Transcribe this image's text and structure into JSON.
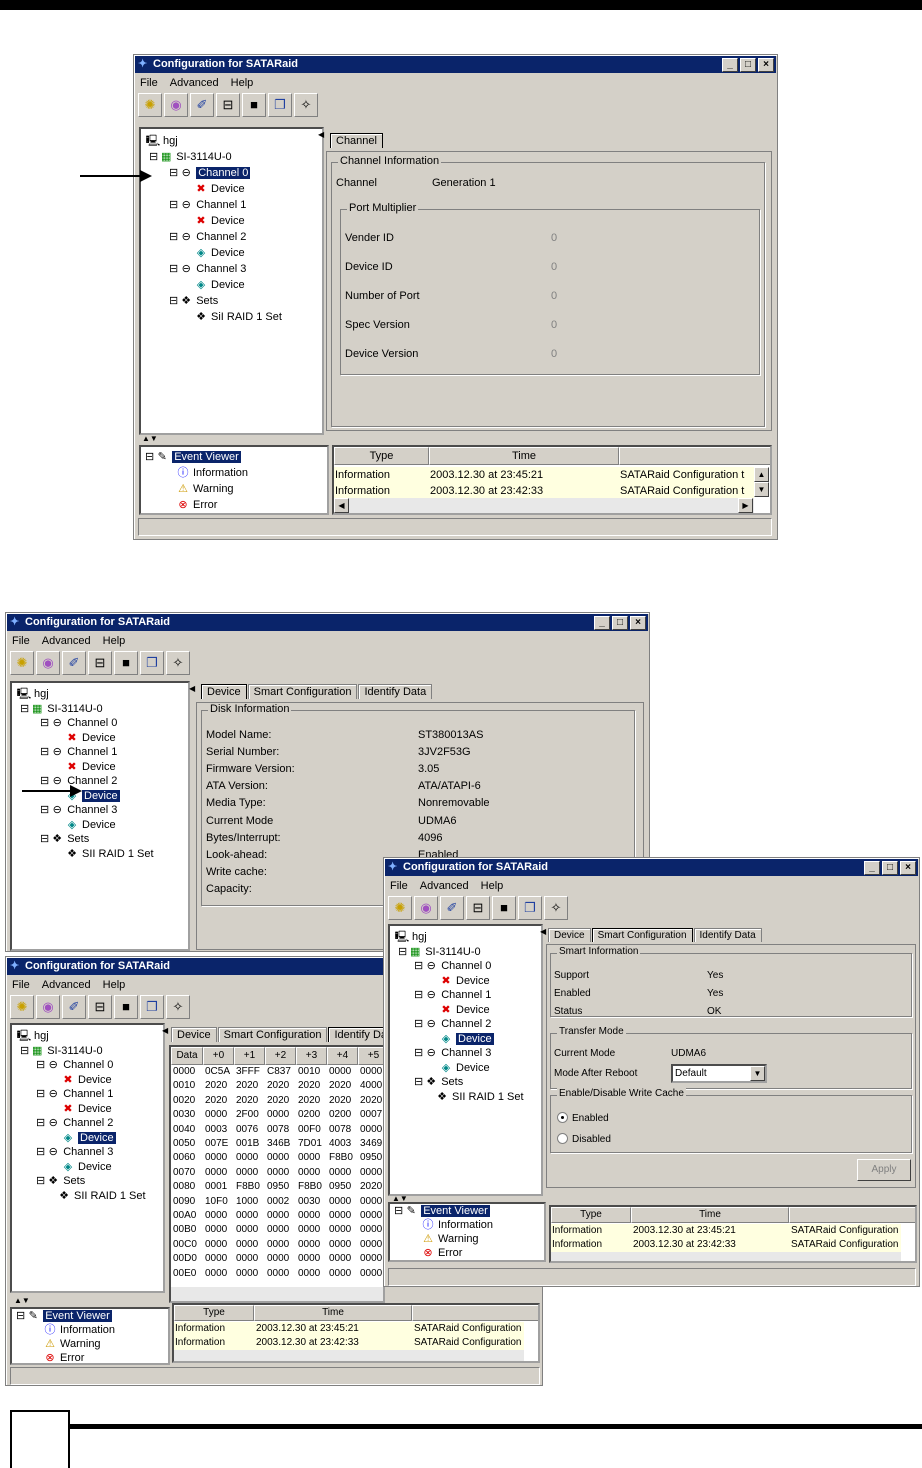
{
  "window_title": "Configuration for SATARaid",
  "title_buttons": [
    "_",
    "□",
    "×"
  ],
  "menu": [
    "File",
    "Advanced",
    "Help"
  ],
  "toolbar_icons": [
    "rescan-icon",
    "cd-icon",
    "wizard-icon",
    "drive-icon",
    "save-icon",
    "copy-icon",
    "find-icon"
  ],
  "tree": {
    "root": "hgj",
    "controller": "SI-3114U-0",
    "ch0": "Channel 0",
    "ch1": "Channel 1",
    "ch2": "Channel 2",
    "ch3": "Channel 3",
    "device": "Device",
    "sets": "Sets",
    "set1": "SiI RAID 1 Set",
    "set1b": "SII RAID 1 Set"
  },
  "events": {
    "viewer": "Event Viewer",
    "info": "Information",
    "warning": "Warning",
    "error": "Error",
    "cols": [
      "Type",
      "Time"
    ],
    "rows": [
      {
        "type": "Information",
        "time": "2003.12.30 at 23:45:21",
        "msg": "SATARaid Configuration t"
      },
      {
        "type": "Information",
        "time": "2003.12.30 at 23:42:33",
        "msg": "SATARaid Configuration t"
      }
    ]
  },
  "channel_tab": {
    "tab": "Channel",
    "group": "Channel Information",
    "channel_label": "Channel",
    "channel_value": "Generation 1",
    "pm_group": "Port Multiplier",
    "pm_rows": [
      {
        "label": "Vender ID",
        "value": "0"
      },
      {
        "label": "Device ID",
        "value": "0"
      },
      {
        "label": "Number of Port",
        "value": "0"
      },
      {
        "label": "Spec Version",
        "value": "0"
      },
      {
        "label": "Device Version",
        "value": "0"
      }
    ]
  },
  "device_tabs": [
    "Device",
    "Smart Configuration",
    "Identify Data"
  ],
  "disk": {
    "group": "Disk Information",
    "rows": [
      {
        "label": "Model Name:",
        "value": "ST380013AS"
      },
      {
        "label": "Serial Number:",
        "value": "3JV2F53G"
      },
      {
        "label": "Firmware Version:",
        "value": "3.05"
      },
      {
        "label": "ATA Version:",
        "value": "ATA/ATAPI-6"
      },
      {
        "label": "Media Type:",
        "value": "Nonremovable"
      },
      {
        "label": "Current Mode",
        "value": "UDMA6"
      },
      {
        "label": "Bytes/Interrupt:",
        "value": "4096"
      },
      {
        "label": "Look-ahead:",
        "value": "Enabled"
      },
      {
        "label": "Write cache:",
        "value": ""
      },
      {
        "label": "Capacity:",
        "value": ""
      }
    ]
  },
  "identify": {
    "cols": [
      "Data",
      "+0",
      "+1",
      "+2",
      "+3",
      "+4",
      "+5"
    ],
    "rows": [
      [
        "0000",
        "0C5A",
        "3FFF",
        "C837",
        "0010",
        "0000",
        "0000"
      ],
      [
        "0010",
        "2020",
        "2020",
        "2020",
        "2020",
        "2020",
        "4000"
      ],
      [
        "0020",
        "2020",
        "2020",
        "2020",
        "2020",
        "2020",
        "2020"
      ],
      [
        "0030",
        "0000",
        "2F00",
        "0000",
        "0200",
        "0200",
        "0007"
      ],
      [
        "0040",
        "0003",
        "0076",
        "0078",
        "00F0",
        "0078",
        "0000"
      ],
      [
        "0050",
        "007E",
        "001B",
        "346B",
        "7D01",
        "4003",
        "3469"
      ],
      [
        "0060",
        "0000",
        "0000",
        "0000",
        "0000",
        "F8B0",
        "0950"
      ],
      [
        "0070",
        "0000",
        "0000",
        "0000",
        "0000",
        "0000",
        "0000"
      ],
      [
        "0080",
        "0001",
        "F8B0",
        "0950",
        "F8B0",
        "0950",
        "2020"
      ],
      [
        "0090",
        "10F0",
        "1000",
        "0002",
        "0030",
        "0000",
        "0000"
      ],
      [
        "00A0",
        "0000",
        "0000",
        "0000",
        "0000",
        "0000",
        "0000"
      ],
      [
        "00B0",
        "0000",
        "0000",
        "0000",
        "0000",
        "0000",
        "0000"
      ],
      [
        "00C0",
        "0000",
        "0000",
        "0000",
        "0000",
        "0000",
        "0000"
      ],
      [
        "00D0",
        "0000",
        "0000",
        "0000",
        "0000",
        "0000",
        "0000"
      ],
      [
        "00E0",
        "0000",
        "0000",
        "0000",
        "0000",
        "0000",
        "0000"
      ]
    ]
  },
  "smart": {
    "group": "Smart Information",
    "rows": [
      {
        "label": "Support",
        "value": "Yes"
      },
      {
        "label": "Enabled",
        "value": "Yes"
      },
      {
        "label": "Status",
        "value": "OK"
      }
    ],
    "transfer_group": "Transfer Mode",
    "current_mode_label": "Current Mode",
    "current_mode_value": "UDMA6",
    "after_reboot_label": "Mode After Reboot",
    "after_reboot_value": "Default",
    "cache_group": "Enable/Disable Write Cache",
    "enabled": "Enabled",
    "disabled": "Disabled",
    "apply": "Apply"
  }
}
